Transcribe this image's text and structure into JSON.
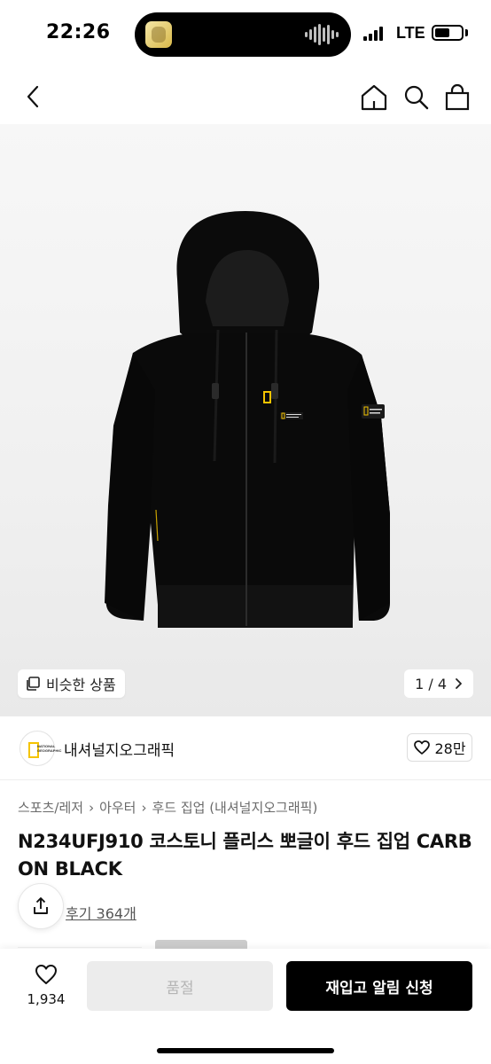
{
  "status_bar": {
    "time": "22:26",
    "network": "LTE",
    "icons": [
      "signal-icon",
      "battery-icon"
    ]
  },
  "nav": {
    "icons": [
      "back-chevron-icon",
      "home-icon",
      "search-icon",
      "shopping-bag-icon"
    ]
  },
  "hero": {
    "similar_label": "비슷한 상품",
    "page_indicator": "1 / 4",
    "image_subject": "black fleece hooded zip-up jacket"
  },
  "brand": {
    "name": "내셔널지오그래픽",
    "likes": "28만",
    "logo_lines": [
      "NATIONAL",
      "GEOGRAPHIC"
    ]
  },
  "product": {
    "breadcrumb": [
      "스포츠/레저",
      "아우터",
      "후드 집업 (내셔널지오그래픽)"
    ],
    "title": "N234UFJ910 코스토니 플리스 뽀글이 후드 집업 CARBON BLACK",
    "review_link": "후기 364개"
  },
  "bottom": {
    "wish_count": "1,934",
    "soldout_label": "품절",
    "restock_label": "재입고 알림 신청"
  },
  "colors": {
    "accent": "#000000",
    "disabled_bg": "#ececec",
    "disabled_text": "#b5b5b5",
    "brand_yellow": "#f5c400"
  }
}
